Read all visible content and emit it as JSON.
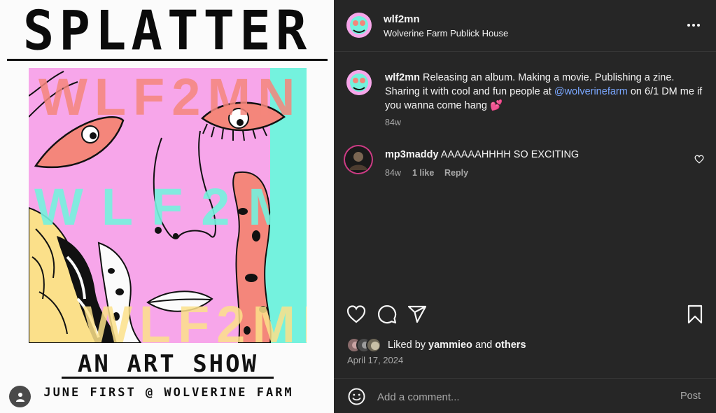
{
  "poster": {
    "title": "SPLATTER",
    "watermark": [
      "WLF2MN",
      "WLF2M",
      "WLF2MN"
    ],
    "subtitle": "AN ART SHOW",
    "date_line": "JUNE FIRST @ WOLVERINE FARM"
  },
  "header": {
    "username": "wlf2mn",
    "location": "Wolverine Farm Publick House",
    "more_icon": "more-horizontal-icon"
  },
  "caption": {
    "username": "wlf2mn",
    "text_1": "Releasing an album. Making a movie. Publishing a zine. Sharing it with cool and fun people at",
    "mention": "@wolverinefarm",
    "text_2": "on 6/1 DM me if you wanna come hang",
    "emoji": "💕",
    "age": "84w"
  },
  "comments": [
    {
      "username": "mp3maddy",
      "text": "AAAAAAHHHH SO EXCITING",
      "age": "84w",
      "likes": "1 like",
      "reply_label": "Reply"
    }
  ],
  "actions": {
    "like_icon": "heart-icon",
    "comment_icon": "comment-icon",
    "share_icon": "share-icon",
    "save_icon": "bookmark-icon"
  },
  "likes": {
    "prefix": "Liked by",
    "user": "yammieo",
    "joiner": "and",
    "others": "others"
  },
  "post_date": "April 17, 2024",
  "comment_bar": {
    "placeholder": "Add a comment...",
    "post_label": "Post"
  },
  "colors": {
    "panel_bg": "#262626",
    "mention_blue": "#7aa7ff",
    "muted_text": "#a8a8a8",
    "poster_pink": "#f7a6ea",
    "poster_salmon": "#f4867b",
    "poster_mint": "#74f2de",
    "poster_yellow": "#fbe08a"
  }
}
